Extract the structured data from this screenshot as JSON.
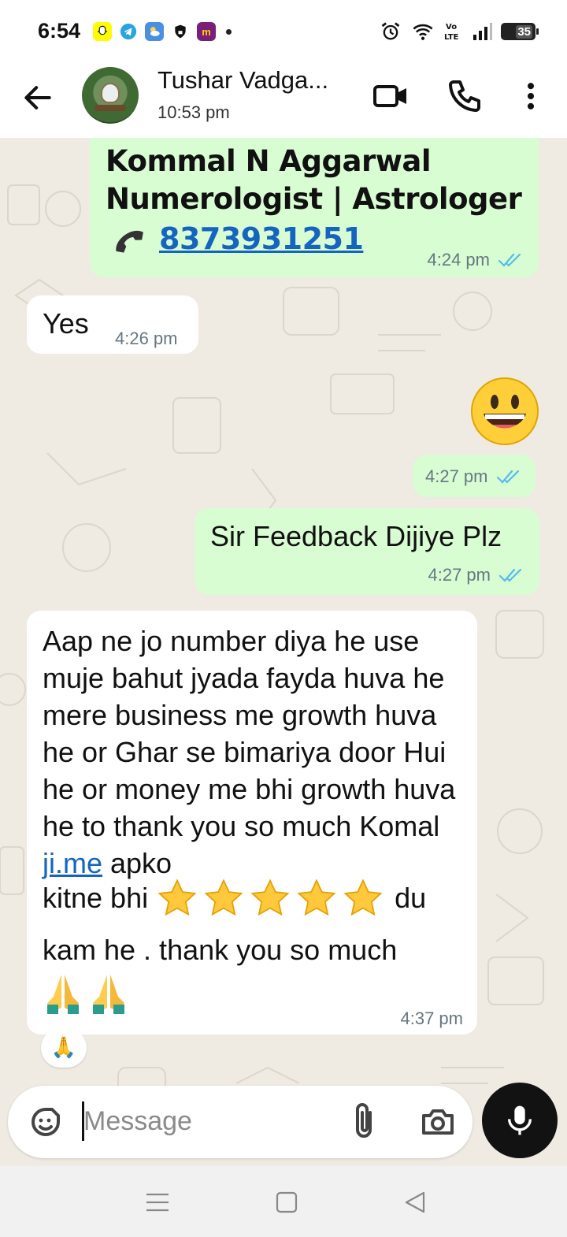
{
  "status_bar": {
    "time": "6:54",
    "battery": "35"
  },
  "header": {
    "contact_name": "Tushar Vadga...",
    "last_seen": "10:53 pm"
  },
  "messages": [
    {
      "direction": "outgoing",
      "lines": [
        "Kommal N Aggarwal",
        "Numerologist | Astrologer"
      ],
      "phone": "8373931251",
      "time": "4:24 pm",
      "status": "read"
    },
    {
      "direction": "incoming",
      "text": "Yes",
      "time": "4:26 pm"
    },
    {
      "direction": "outgoing",
      "emoji": "grinning-face",
      "time": "4:27 pm",
      "status": "read"
    },
    {
      "direction": "outgoing",
      "text": "Sir Feedback Dijiye Plz",
      "time": "4:27 pm",
      "status": "read"
    },
    {
      "direction": "incoming",
      "text_before_link": "Aap ne jo number diya he use muje bahut jyada fayda huva he mere business me growth huva he or Ghar se bimariya door Hui he or money me bhi growth huva he to thank you so much Komal ",
      "link": "ji.me",
      "text_after_link": " apko",
      "stars_prefix": "kitne bhi",
      "stars_count": 5,
      "stars_suffix": "du",
      "closing": "kam he . thank you so much",
      "closing_emoji": "🙏🙏",
      "time": "4:37 pm",
      "reaction": "🙏"
    }
  ],
  "composer": {
    "placeholder": "Message"
  },
  "colors": {
    "outgoing_bubble": "#d9fdd3",
    "incoming_bubble": "#ffffff",
    "chat_bg": "#efeae2",
    "read_ticks": "#53bdeb",
    "link": "#1565c0"
  }
}
